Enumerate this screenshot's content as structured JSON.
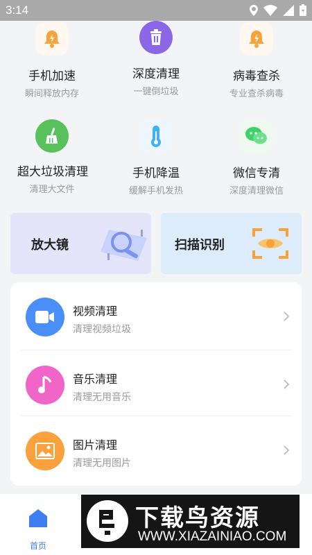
{
  "status_bar": {
    "time": "3:14"
  },
  "tools": [
    {
      "title": "手机加速",
      "subtitle": "瞬间释放内存",
      "icon": "bell-bolt-icon"
    },
    {
      "title": "深度清理",
      "subtitle": "一键倒垃圾",
      "icon": "trash-icon"
    },
    {
      "title": "病毒查杀",
      "subtitle": "专业查杀病毒",
      "icon": "bell-bolt-icon"
    },
    {
      "title": "超大垃圾清理",
      "subtitle": "清理大文件",
      "icon": "broom-icon"
    },
    {
      "title": "手机降温",
      "subtitle": "缓解手机发热",
      "icon": "thermometer-icon"
    },
    {
      "title": "微信专清",
      "subtitle": "深度清理微信",
      "icon": "wechat-icon"
    }
  ],
  "banners": [
    {
      "label": "放大镜",
      "icon": "magnifier-icon"
    },
    {
      "label": "扫描识别",
      "icon": "scan-eye-icon"
    }
  ],
  "list": [
    {
      "title": "视频清理",
      "subtitle": "清理视频垃圾",
      "icon": "video-icon",
      "color": "#4a8ff7"
    },
    {
      "title": "音乐清理",
      "subtitle": "清理无用音乐",
      "icon": "music-icon",
      "color": "#f065c7"
    },
    {
      "title": "图片清理",
      "subtitle": "清理无用图片",
      "icon": "image-icon",
      "color": "#f9a13d"
    }
  ],
  "tabs": [
    {
      "label": "首页",
      "icon": "home-icon",
      "active": true
    },
    {
      "label": "",
      "icon": "tab-icon"
    },
    {
      "label": "",
      "icon": "tab-icon"
    },
    {
      "label": "",
      "icon": "tab-icon"
    }
  ],
  "watermark": {
    "name": "下载鸟资源",
    "url": "WWW.XIAZAINIAO.COM"
  },
  "colors": {
    "accent": "#3f7ef0",
    "banner_left": "#e4e4fb",
    "banner_right": "#dcecfb"
  }
}
